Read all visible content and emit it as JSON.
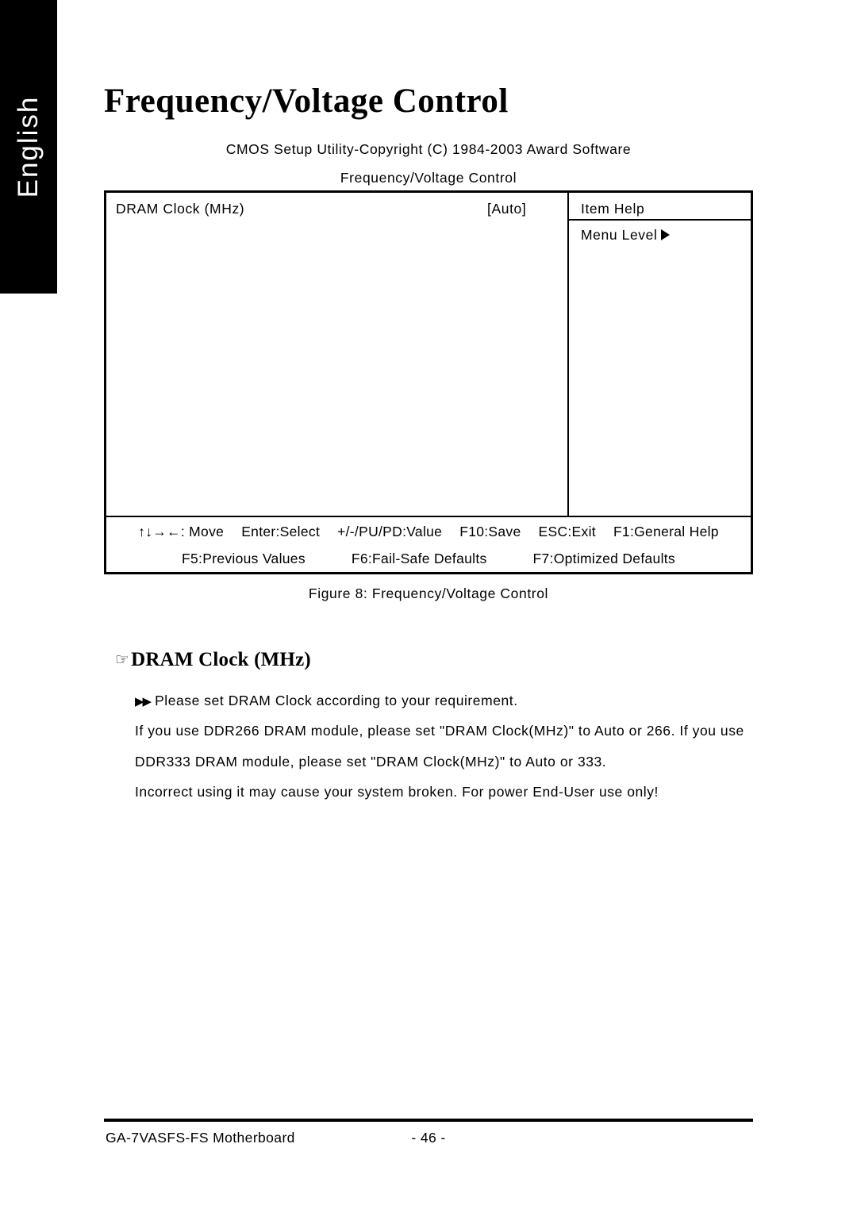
{
  "sidebar": {
    "language_tab": "English"
  },
  "page": {
    "title": "Frequency/Voltage Control"
  },
  "bios": {
    "header_line_1": "CMOS Setup Utility-Copyright (C) 1984-2003 Award Software",
    "header_line_2": "Frequency/Voltage Control",
    "item": {
      "label": "DRAM Clock (MHz)",
      "value": "[Auto]"
    },
    "help": {
      "title": "Item Help",
      "menu_level_label": "Menu Level",
      "menu_level_icon": "triangle-right-icon"
    },
    "keys": {
      "move": "↑↓→←: Move",
      "enter_select": "Enter:Select",
      "value": "+/-/PU/PD:Value",
      "f10_save": "F10:Save",
      "esc_exit": "ESC:Exit",
      "f1_general_help": "F1:General Help",
      "f5_previous_values": "F5:Previous Values",
      "f6_fail_safe": "F6:Fail-Safe Defaults",
      "f7_optimized": "F7:Optimized Defaults"
    }
  },
  "figure": {
    "caption": "Figure 8: Frequency/Voltage Control"
  },
  "section": {
    "hand_icon": "☞",
    "heading": "DRAM Clock (MHz)"
  },
  "body": {
    "bullet_icon": "▶▶",
    "paragraphs": [
      "Please set DRAM Clock according to your requirement.",
      "If you use DDR266 DRAM module, please set \"DRAM Clock(MHz)\" to Auto or 266. If you use",
      "DDR333 DRAM module, please set \"DRAM Clock(MHz)\" to Auto or 333.",
      "Incorrect using it may cause your system broken. For power End-User use only!"
    ]
  },
  "footer": {
    "product": "GA-7VASFS-FS Motherboard",
    "page_number": "- 46 -"
  },
  "colors": {
    "ink": "#000000",
    "paper": "#ffffff",
    "tab_background": "#000000",
    "tab_text": "#ffffff"
  }
}
